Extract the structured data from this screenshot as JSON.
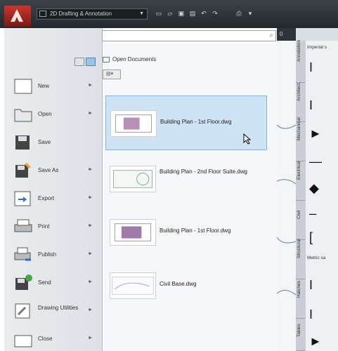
{
  "titlebar": {
    "workspace": "2D Drafting & Annotation",
    "canvas_tab": "0"
  },
  "search": {
    "placeholder": ""
  },
  "documents": {
    "header": "Open Documents",
    "items": [
      {
        "name": "Building Plan - 1st Floor.dwg",
        "selected": true
      },
      {
        "name": "Building Plan - 2nd Floor Suite.dwg",
        "selected": false
      },
      {
        "name": "Building Plan - 1st Floor.dwg",
        "selected": false
      },
      {
        "name": "Civil Base.dwg",
        "selected": false
      }
    ]
  },
  "commands": [
    {
      "label": "New",
      "icon": "new-icon"
    },
    {
      "label": "Open",
      "icon": "open-icon"
    },
    {
      "label": "Save",
      "icon": "save-icon"
    },
    {
      "label": "Save As",
      "icon": "save-as-icon"
    },
    {
      "label": "Export",
      "icon": "export-icon"
    },
    {
      "label": "Print",
      "icon": "print-icon"
    },
    {
      "label": "Publish",
      "icon": "publish-icon"
    },
    {
      "label": "Send",
      "icon": "send-icon"
    },
    {
      "label": "Drawing Utilities",
      "icon": "drawing-utilities-icon"
    },
    {
      "label": "Close",
      "icon": "close-icon"
    }
  ],
  "palette": {
    "section1": "Imperial s",
    "section2": "Metric sa",
    "tabs": [
      "Annotation",
      "Architect.",
      "Mechanical",
      "Electrical",
      "Civil",
      "Structural",
      "Hatches",
      "Tables"
    ]
  },
  "colors": {
    "accent": "#c9362f",
    "selection": "#cfe3f6"
  }
}
